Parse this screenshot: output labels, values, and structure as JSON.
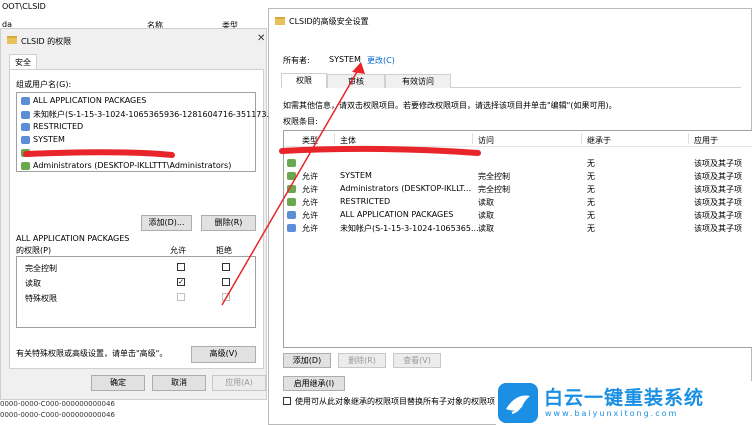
{
  "background_window": {
    "path": "OOT\\CLSID",
    "col_name": "da",
    "col_header1": "名称",
    "col_header2": "类型",
    "bottom_line1": "0000-0000-C000-000000000046",
    "bottom_line2": "0000-0000-C000-000000000046"
  },
  "perm_dialog": {
    "title": "CLSID 的权限",
    "tab": "安全",
    "group_label": "组或用户名(G):",
    "users": [
      "ALL APPLICATION PACKAGES",
      "未知帐户(S-1-15-3-1024-1065365936-1281604716-351173...",
      "RESTRICTED",
      "SYSTEM",
      "",
      "Administrators (DESKTOP-IKLLTTT\\Administrators)"
    ],
    "add_btn": "添加(D)...",
    "remove_btn": "删除(R)",
    "perm_for_line1": "ALL APPLICATION PACKAGES",
    "perm_for_line2": "的权限(P)",
    "allow": "允许",
    "deny": "拒绝",
    "perms": [
      {
        "name": "完全控制",
        "allow": "",
        "deny": ""
      },
      {
        "name": "读取",
        "allow": "✓",
        "deny": ""
      },
      {
        "name": "特殊权限",
        "allow": "",
        "deny": ""
      }
    ],
    "special_hint": "有关特殊权限或高级设置，请单击\"高级\"。",
    "advanced_btn": "高级(V)",
    "ok": "确定",
    "cancel": "取消",
    "apply": "应用(A)"
  },
  "adv_dialog": {
    "title": "CLSID的高级安全设置",
    "owner_label": "所有者:",
    "owner_value": "SYSTEM",
    "change_link": "更改(C)",
    "tabs": [
      "权限",
      "审核",
      "有效访问"
    ],
    "info_text": "如需其他信息，请双击权限项目。若要修改权限项目，请选择该项目并单击\"编辑\"(如果可用)。",
    "entries_label": "权限条目:",
    "headers": [
      "类型",
      "主体",
      "访问",
      "继承于",
      "应用于"
    ],
    "rows": [
      {
        "type": "",
        "principal": "",
        "access": "",
        "inherit": "无",
        "apply": "该项及其子项"
      },
      {
        "type": "允许",
        "principal": "SYSTEM",
        "access": "完全控制",
        "inherit": "无",
        "apply": "该项及其子项"
      },
      {
        "type": "允许",
        "principal": "Administrators (DESKTOP-IKLLT...",
        "access": "完全控制",
        "inherit": "无",
        "apply": "该项及其子项"
      },
      {
        "type": "允许",
        "principal": "RESTRICTED",
        "access": "读取",
        "inherit": "无",
        "apply": "该项及其子项"
      },
      {
        "type": "允许",
        "principal": "ALL APPLICATION PACKAGES",
        "access": "读取",
        "inherit": "无",
        "apply": "该项及其子项"
      },
      {
        "type": "允许",
        "principal": "未知帐户(S-1-15-3-1024-1065365...",
        "access": "读取",
        "inherit": "无",
        "apply": "该项及其子项"
      }
    ],
    "add_btn": "添加(D)",
    "remove_btn": "删除(R)",
    "view_btn": "查看(V)",
    "enable_inherit_btn": "启用继承(I)",
    "replace_checkbox_label": "使用可从此对象继承的权限项目替换所有子对象的权限项"
  },
  "watermark": {
    "brand": "白云一键重装系统",
    "url": "www.baiyunxitong.com"
  },
  "colors": {
    "annotation_red": "#e8252a",
    "link_blue": "#0066cc",
    "brand_blue": "#1a8fe3"
  }
}
